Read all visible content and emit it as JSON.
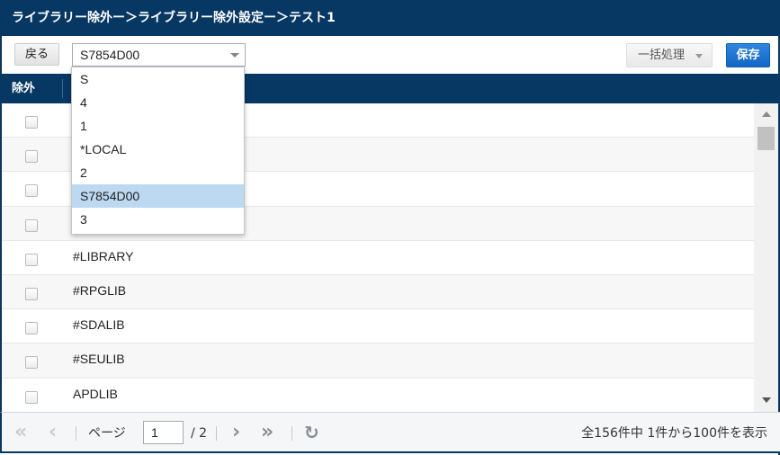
{
  "title": "ライブラリー除外ー＞ライブラリー除外設定ー＞テスト1",
  "toolbar": {
    "back_label": "戻る",
    "selected_value": "S7854D00",
    "bulk_label": "一括処理",
    "save_label": "保存"
  },
  "grid": {
    "header_exclude": "除外",
    "rows": [
      {
        "name": "",
        "checked": false
      },
      {
        "name": "",
        "checked": false
      },
      {
        "name": "",
        "checked": false
      },
      {
        "name": "",
        "checked": false
      },
      {
        "name": "#LIBRARY",
        "checked": false
      },
      {
        "name": "#RPGLIB",
        "checked": false
      },
      {
        "name": "#SDALIB",
        "checked": false
      },
      {
        "name": "#SEULIB",
        "checked": false
      },
      {
        "name": "APDLIB",
        "checked": false
      }
    ]
  },
  "dropdown": {
    "options": [
      "S",
      "4",
      "1",
      "*LOCAL",
      "2",
      "S7854D00",
      "3"
    ],
    "selected_index": 5
  },
  "pager": {
    "page_label": "ページ",
    "current_page": "1",
    "total_pages": "/ 2",
    "summary": "全156件中 1件から100件を表示"
  },
  "icons": {
    "first": "first-page-icon",
    "prev": "prev-page-icon",
    "next": "next-page-icon",
    "last": "last-page-icon",
    "refresh": "refresh-icon"
  },
  "colors": {
    "header_bg": "#073763",
    "save_button": "#1a6fd0",
    "selected_option": "#bcd9f1"
  }
}
